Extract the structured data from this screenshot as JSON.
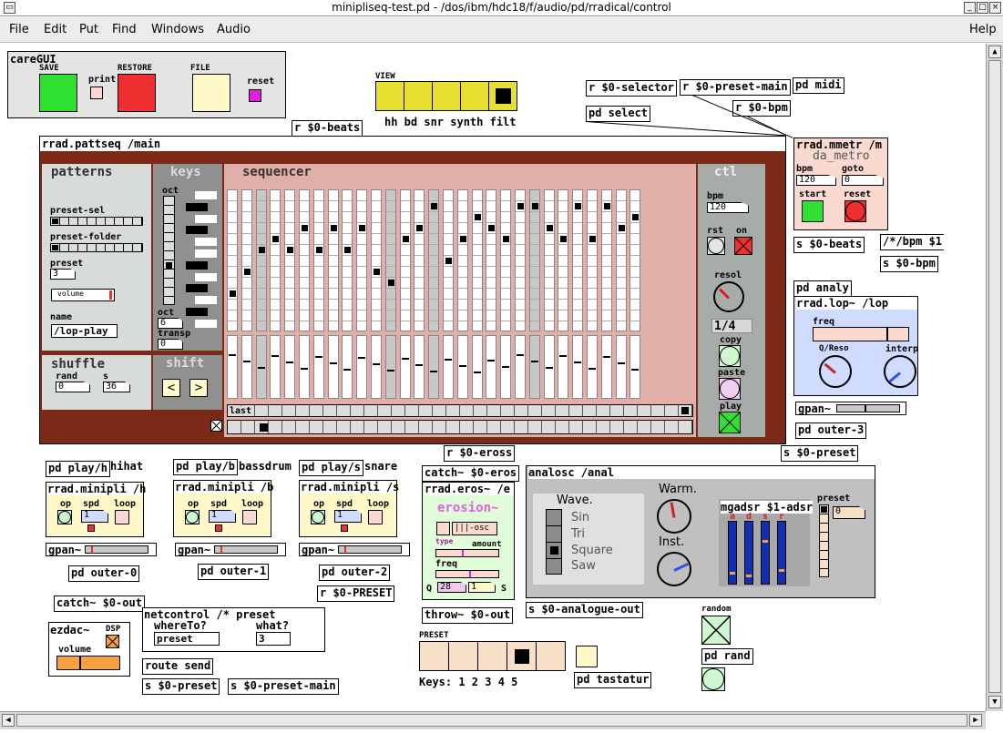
{
  "window": {
    "title": "minipliseq-test.pd  - /dos/ibm/hdc18/f/audio/pd/rradical/control"
  },
  "menu": [
    "File",
    "Edit",
    "Put",
    "Find",
    "Windows",
    "Audio",
    "Help"
  ],
  "caregui": {
    "title": "careGUI",
    "save": "SAVE",
    "print": "print",
    "restore": "RESTORE",
    "file": "FILE",
    "reset": "reset"
  },
  "view": {
    "title": "VIEW",
    "labels": "hh  bd  snr  synth  filt"
  },
  "objects": {
    "beats_r": "r $0-beats",
    "selector_r": "r $0-selector",
    "preset_main_r": "r $0-preset-main",
    "pd_midi": "pd midi",
    "pd_select": "pd select",
    "bpm_r": "r $0-bpm",
    "pattseq": "rrad.pattseq /main",
    "mmetr": "rrad.mmetr /m",
    "beats_s": "s $0-beats",
    "bpm_msg": "/*/bpm $1",
    "bpm_s": "s $0-bpm",
    "pd_analy": "pd analy",
    "lop": "rrad.lop~ /lop",
    "gpan3": "gpan~",
    "outer3": "pd outer-3",
    "preset_s_right": "s $0-preset",
    "eross_r": "r $0-eross",
    "catch_eros": "catch~ $0-eros",
    "eros": "rrad.eros~ /e",
    "throw_out": "throw~ $0-out",
    "analosc": "analosc /anal",
    "analogue_out": "s $0-analogue-out",
    "play_h": "pd play/h",
    "hihat": "hihat",
    "mini_h": "rrad.minipli /h",
    "gpan0": "gpan~",
    "outer0": "pd outer-0",
    "play_b": "pd play/b",
    "bassdrum": "bassdrum",
    "mini_b": "rrad.minipli /b",
    "gpan1": "gpan~",
    "outer1": "pd outer-1",
    "play_s": "pd play/s",
    "snare": "snare",
    "mini_s": "rrad.minipli /s",
    "gpan2": "gpan~",
    "outer2": "pd outer-2",
    "preset_r": "r $0-PRESET",
    "catch_out": "catch~ $0-out",
    "ezdac": "ezdac~",
    "dsp": "DSP",
    "volume": "volume",
    "netcontrol": "netcontrol /* preset",
    "whereto": "whereTo?",
    "what": "what?",
    "whereto_val": "preset",
    "what_val": "3",
    "route_send": "route send",
    "preset_s": "s $0-preset",
    "preset_main_s": "s $0-preset-main",
    "preset_label": "PRESET",
    "keys": "Keys: 1 2 3 4 5",
    "pd_tastatur": "pd tastatur",
    "random": "random",
    "pd_rand": "pd rand"
  },
  "pattseq": {
    "patterns": "patterns",
    "preset_sel": "preset-sel",
    "preset_folder": "preset-folder",
    "preset": "preset",
    "preset_val": "3",
    "volume": "volume",
    "name": "name",
    "name_val": "/lop-play",
    "keys": "keys",
    "oct": "oct",
    "oct1": "oct",
    "oct1_val": "6",
    "transp": "transp",
    "transp_val": "0",
    "sequencer": "sequencer",
    "ctl": "ctl",
    "bpm": "bpm",
    "bpm_val": "120",
    "rst": "rst",
    "on": "on",
    "resol": "resol",
    "resol_val": "1/4",
    "copy": "copy",
    "paste": "paste",
    "play": "play",
    "shuffle": "shuffle",
    "rand": "rand",
    "rand_val": "0",
    "s": "s",
    "s_val": "36",
    "shift": "shift",
    "last": "last"
  },
  "mmetr": {
    "name": "da_metro",
    "bpm": "bpm",
    "bpm_val": "120",
    "goto": "goto",
    "goto_val": "0",
    "start": "start",
    "reset": "reset"
  },
  "lop": {
    "freq": "freq",
    "qreso": "Q/Reso",
    "interp": "interp"
  },
  "eros": {
    "name": "erosion~",
    "osc": "|||-osc",
    "type": "type",
    "amount": "amount",
    "freq": "freq",
    "q": "Q",
    "q_val": "28",
    "s": "S",
    "s_val": "1"
  },
  "analosc": {
    "wave": "Wave.",
    "options": [
      "Sin",
      "Tri",
      "Square",
      "Saw"
    ],
    "warm": "Warm.",
    "inst": "Inst.",
    "adsr": "mgadsr $1-adsr",
    "a": "a",
    "d": "d",
    "s": "s",
    "r": "r",
    "preset": "preset",
    "preset_val": "0"
  },
  "mini": {
    "op": "op",
    "spd": "spd",
    "spd_val": "1",
    "loop": "loop"
  },
  "seq": {
    "steps": [
      9,
      7,
      5,
      4,
      5,
      3,
      5,
      3,
      5,
      3,
      7,
      8,
      4,
      3,
      1,
      6,
      4,
      2,
      3,
      4,
      1,
      1,
      3,
      4,
      1,
      4,
      1,
      3,
      2
    ],
    "shades": [
      2,
      11,
      14,
      21
    ]
  },
  "colors": {
    "pattseq_bg": "#7b2a1a",
    "panel_gray": "#d8dcd8",
    "dark_gray": "#909090",
    "seq_bg": "#e0b0a8",
    "ctl_bg": "#a8aca8",
    "yellow": "#e8e030",
    "green": "#30e030",
    "red": "#f03030",
    "cream": "#fff8c8",
    "lightblue": "#d0dcff",
    "peach": "#f8e0c8",
    "orange": "#f8a040",
    "eros_green": "#e0fcd8",
    "magenta": "#e020e0",
    "adsr_blue": "#1030b0",
    "salmon": "#fadad0"
  }
}
